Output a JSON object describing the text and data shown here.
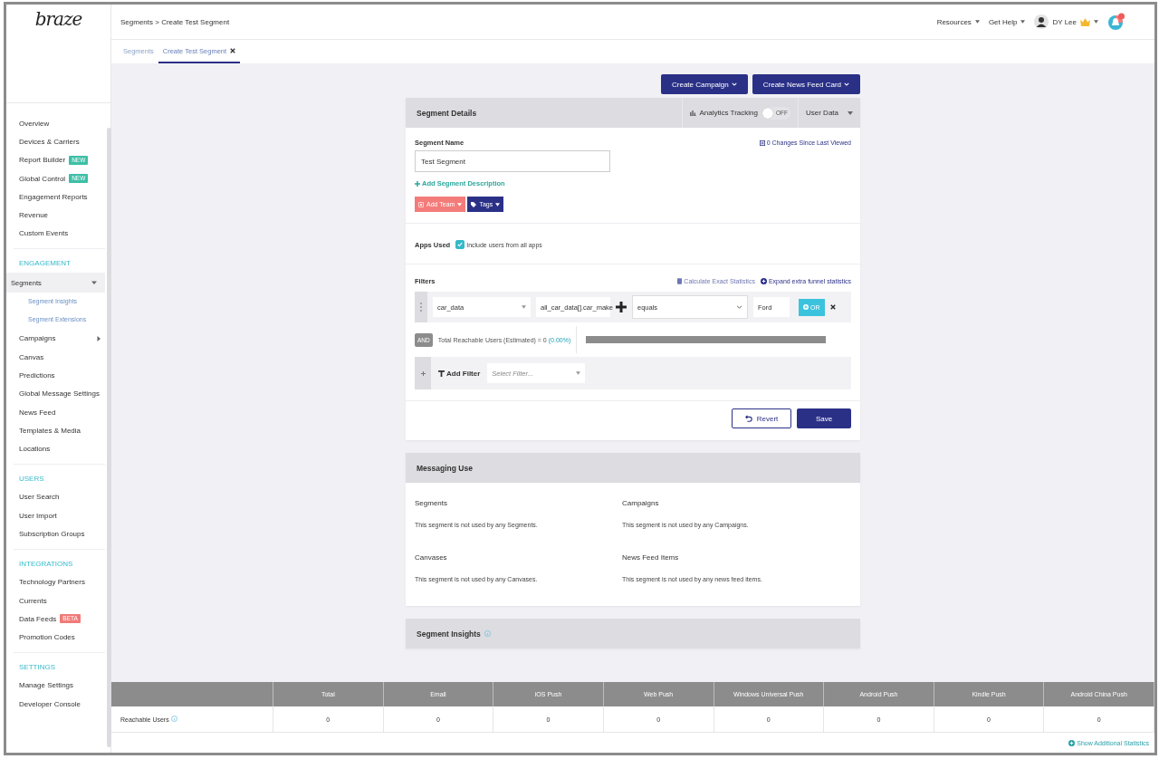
{
  "sidebar": {
    "logo": "braze",
    "sections": [
      {
        "items": [
          {
            "label": "Overview",
            "selected": false
          },
          {
            "label": "Devices & Carriers",
            "selected": false
          },
          {
            "label": "Report Builder",
            "selected": false,
            "badge": {
              "text": "NEW",
              "color": "#3dbfa6"
            }
          },
          {
            "label": "Global Control",
            "selected": false,
            "badge": {
              "text": "NEW",
              "color": "#3dbfa6"
            }
          },
          {
            "label": "Engagement Reports",
            "selected": false
          },
          {
            "label": "Revenue",
            "selected": false
          },
          {
            "label": "Custom Events",
            "selected": false
          }
        ]
      },
      {
        "heading": "ENGAGEMENT",
        "items": [
          {
            "label": "Segments",
            "selected": true,
            "expanded": true,
            "children": [
              {
                "label": "Segment Insights",
                "selected": false
              },
              {
                "label": "Segment Extensions",
                "selected": false
              }
            ]
          },
          {
            "label": "Campaigns",
            "selected": false,
            "expanded": false
          },
          {
            "label": "Canvas",
            "selected": false
          },
          {
            "label": "Predictions",
            "selected": false
          },
          {
            "label": "Global Message Settings",
            "selected": false
          },
          {
            "label": "News Feed",
            "selected": false
          },
          {
            "label": "Templates & Media",
            "selected": false
          },
          {
            "label": "Locations",
            "selected": false
          }
        ]
      },
      {
        "heading": "USERS",
        "items": [
          {
            "label": "User Search",
            "selected": false
          },
          {
            "label": "User Import",
            "selected": false
          },
          {
            "label": "Subscription Groups",
            "selected": false
          }
        ]
      },
      {
        "heading": "INTEGRATIONS",
        "items": [
          {
            "label": "Technology Partners",
            "selected": false
          },
          {
            "label": "Currents",
            "selected": false
          },
          {
            "label": "Data Feeds",
            "selected": false,
            "badge": {
              "text": "BETA",
              "color": "#f07b78"
            }
          },
          {
            "label": "Promotion Codes",
            "selected": false
          }
        ]
      },
      {
        "heading": "SETTINGS",
        "items": [
          {
            "label": "Manage Settings",
            "selected": false
          },
          {
            "label": "Developer Console",
            "selected": false
          }
        ]
      }
    ]
  },
  "header": {
    "breadcrumb": "Segments > Create Test Segment",
    "menus": [
      "Resources",
      "Get Help"
    ],
    "user": "DY Lee"
  },
  "tabs": [
    {
      "label": "Segments",
      "selected": false,
      "closable": false
    },
    {
      "label": "Create Test Segment",
      "selected": true,
      "closable": true
    }
  ],
  "actions": [
    "Create Campaign",
    "Create News Feed Card"
  ],
  "details": {
    "title": "Segment Details",
    "analytics": {
      "label": "Analytics Tracking",
      "toggle": "OFF",
      "on": false
    },
    "user_data": "User Data",
    "name_label": "Segment Name",
    "changes": "0 Changes Since Last Viewed",
    "name_value": "Test Segment",
    "add_description": "Add Segment Description",
    "team": "Add Team",
    "tags": "Tags",
    "apps_label": "Apps Used",
    "apps_checkbox": {
      "label": "Include users from all apps",
      "checked": true
    },
    "filters_label": "Filters",
    "calc": "Calculate Exact Statistics",
    "expand": "Expand extra funnel statistics",
    "filter": {
      "property": "car_data",
      "field": "all_car_data[].car_make",
      "operator": "equals",
      "value": "Ford",
      "or": "OR"
    },
    "and": "AND",
    "reach": "Total Reachable Users (Estimated) = 0 ",
    "reach_pct": "(0.00%)",
    "add_filter": "Add Filter",
    "select_placeholder": "Select Filter...",
    "revert": "Revert",
    "save": "Save"
  },
  "messaging": {
    "title": "Messaging Use",
    "groups": [
      {
        "title": "Segments",
        "text": "This segment is not used by any Segments."
      },
      {
        "title": "Campaigns",
        "text": "This segment is not used by any Campaigns."
      },
      {
        "title": "Canvases",
        "text": "This segment is not used by any Canvases."
      },
      {
        "title": "News Feed Items",
        "text": "This segment is not used by any news feed items."
      }
    ]
  },
  "insights": {
    "title": "Segment Insights"
  },
  "stats": {
    "columns": [
      "Total",
      "Email",
      "iOS Push",
      "Web Push",
      "Windows Universal Push",
      "Android Push",
      "Kindle Push",
      "Android China Push"
    ],
    "rows": [
      {
        "label": "Reachable Users",
        "cells": [
          "0",
          "0",
          "0",
          "0",
          "0",
          "0",
          "0",
          "0"
        ]
      }
    ],
    "more": "Show Additional Statistics"
  }
}
